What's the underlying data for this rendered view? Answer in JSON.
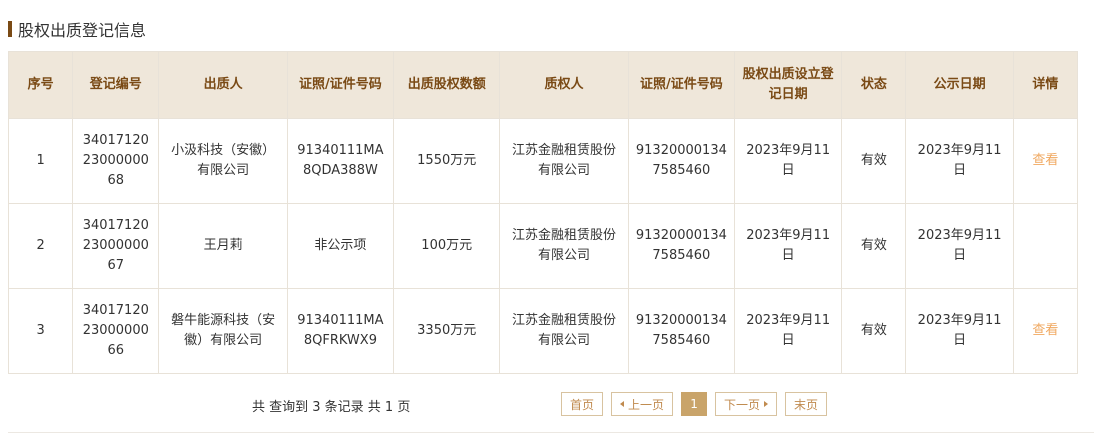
{
  "section": {
    "title": "股权出质登记信息"
  },
  "table": {
    "headers": [
      "序号",
      "登记编号",
      "出质人",
      "证照/证件号码",
      "出质股权数额",
      "质权人",
      "证照/证件号码",
      "股权出质设立登记日期",
      "状态",
      "公示日期",
      "详情"
    ],
    "rows": [
      {
        "no": "1",
        "reg_no": "340171202300000068",
        "pledgor": "小汲科技（安徽）有限公司",
        "pledgor_id": "91340111MA8QDA388W",
        "amount": "1550万元",
        "pledgee": "江苏金融租赁股份有限公司",
        "pledgee_id": "913200001347585460",
        "date": "2023年9月11日",
        "status": "有效",
        "pub_date": "2023年9月11日",
        "detail": "查看"
      },
      {
        "no": "2",
        "reg_no": "340171202300000067",
        "pledgor": "王月莉",
        "pledgor_id": "非公示项",
        "amount": "100万元",
        "pledgee": "江苏金融租赁股份有限公司",
        "pledgee_id": "913200001347585460",
        "date": "2023年9月11日",
        "status": "有效",
        "pub_date": "2023年9月11日",
        "detail": ""
      },
      {
        "no": "3",
        "reg_no": "340171202300000066",
        "pledgor": "磐牛能源科技（安徽）有限公司",
        "pledgor_id": "91340111MA8QFRKWX9",
        "amount": "3350万元",
        "pledgee": "江苏金融租赁股份有限公司",
        "pledgee_id": "913200001347585460",
        "date": "2023年9月11日",
        "status": "有效",
        "pub_date": "2023年9月11日",
        "detail": "查看"
      }
    ]
  },
  "pagination": {
    "summary": "共 查询到 3 条记录 共 1 页",
    "first": "首页",
    "prev": "上一页",
    "current": "1",
    "next": "下一页",
    "last": "末页"
  },
  "colors": {
    "header_bg": "#efe7da",
    "header_text": "#7a4a15",
    "link": "#f0a860",
    "accent": "#c9a46a"
  }
}
